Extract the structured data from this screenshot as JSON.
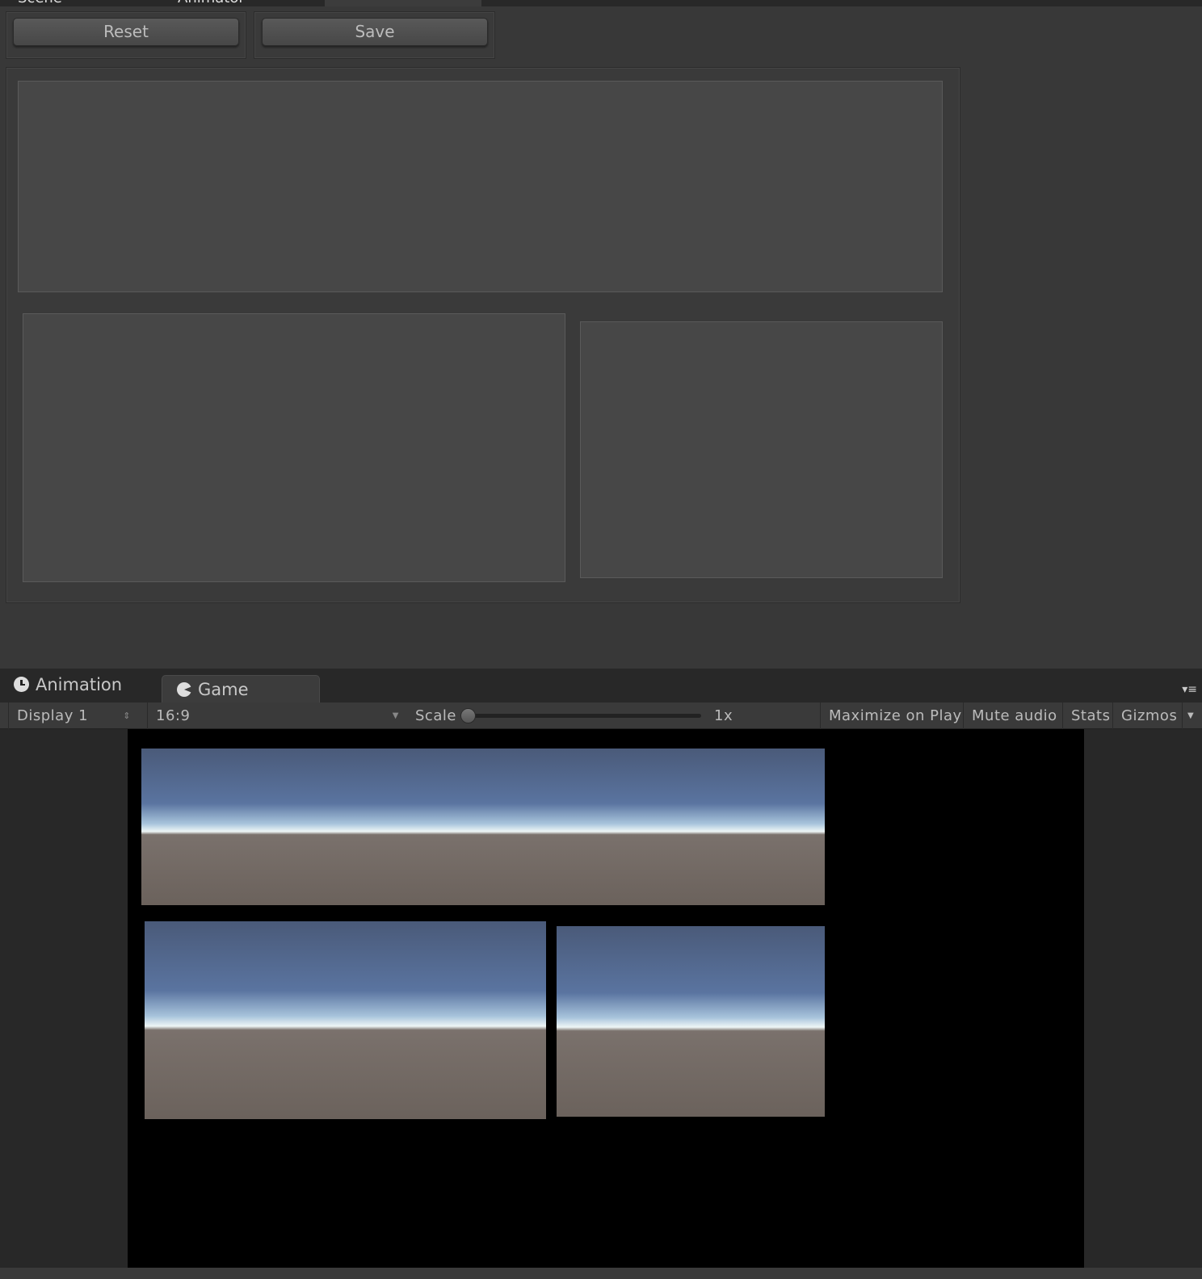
{
  "top_tabs": [
    {
      "label": "Scene"
    },
    {
      "label": "Animator"
    },
    {
      "label": ""
    }
  ],
  "toolbar_buttons": {
    "reset": "Reset",
    "save": "Save"
  },
  "bottom_tabs": [
    {
      "label": "Animation",
      "icon": "clock-icon"
    },
    {
      "label": "Game",
      "icon": "pacman-icon"
    }
  ],
  "game_toolbar": {
    "display": "Display 1",
    "aspect": "16:9",
    "scale_label": "Scale",
    "scale_value": "1x",
    "scale_fraction": 0,
    "maximize": "Maximize on Play",
    "mute": "Mute audio",
    "stats": "Stats",
    "gizmos": "Gizmos"
  }
}
